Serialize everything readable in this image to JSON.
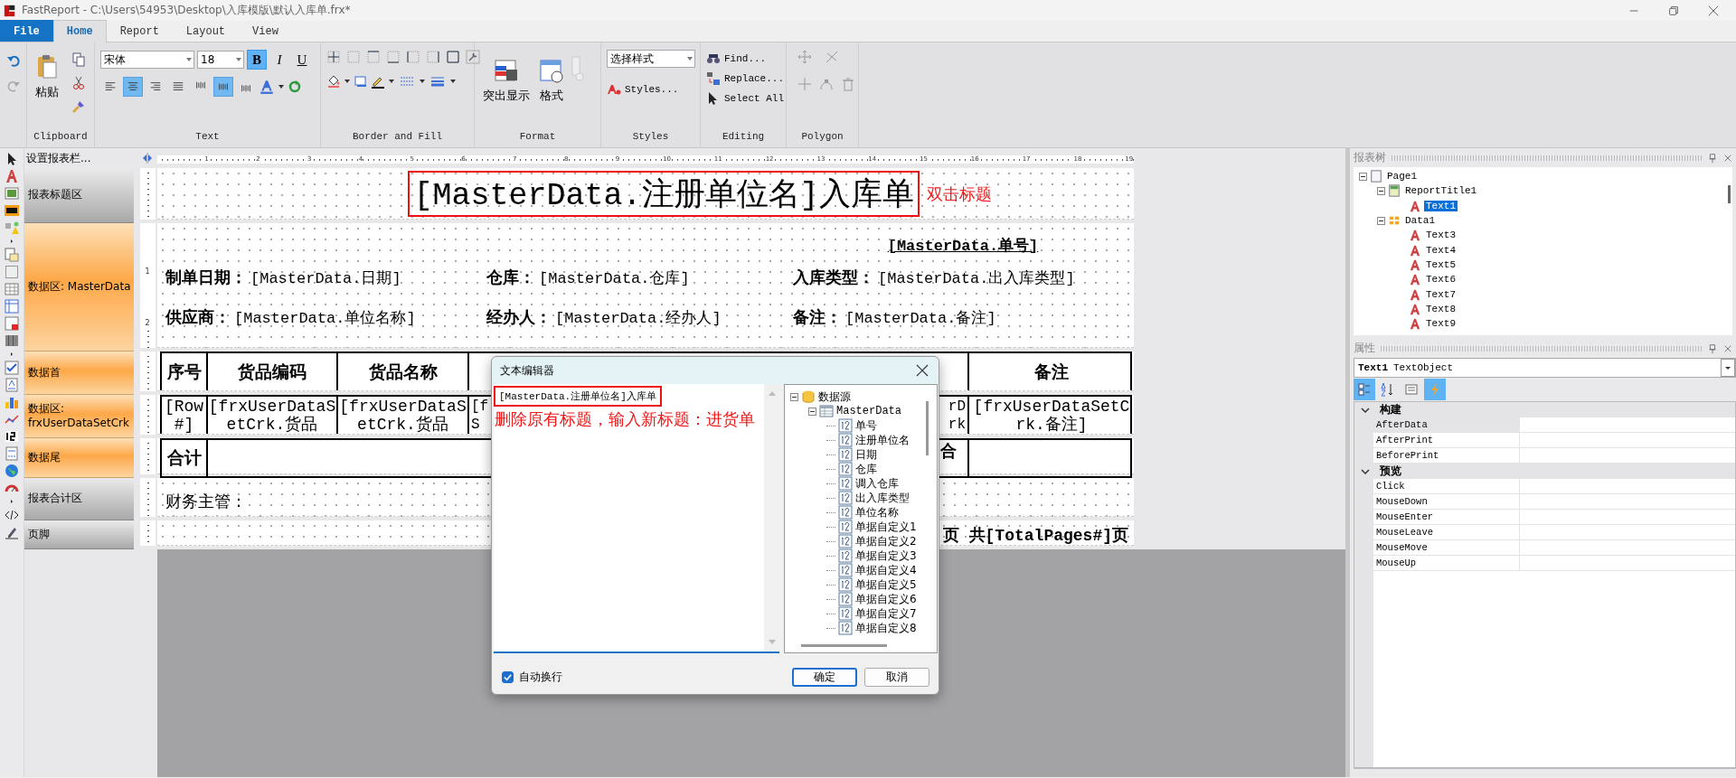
{
  "window": {
    "title": "FastReport - C:\\Users\\54953\\Desktop\\入库模版\\默认入库单.frx*"
  },
  "ribbon": {
    "tabs": [
      {
        "label": "File",
        "kind": "file",
        "selected": false
      },
      {
        "label": "Home",
        "kind": "tab",
        "selected": true
      },
      {
        "label": "Report",
        "kind": "tab",
        "selected": false
      },
      {
        "label": "Layout",
        "kind": "tab",
        "selected": false
      },
      {
        "label": "View",
        "kind": "tab",
        "selected": false
      }
    ],
    "groups": [
      {
        "kind": "clipboard",
        "label": "Clipboard",
        "paste": "粘贴"
      },
      {
        "kind": "text",
        "label": "Text",
        "font": "宋体",
        "size": "18",
        "styles": [
          {
            "label": "B",
            "selected": true
          },
          {
            "label": "I",
            "selected": false
          },
          {
            "label": "U",
            "selected": false
          }
        ],
        "align": [
          {
            "selected": false
          },
          {
            "selected": true
          },
          {
            "selected": false
          },
          {
            "selected": false
          }
        ],
        "valign": [
          {
            "selected": false
          },
          {
            "selected": true
          },
          {
            "selected": false
          }
        ]
      },
      {
        "kind": "border",
        "label": "Border and Fill"
      },
      {
        "kind": "format",
        "label": "Format",
        "buttons": [
          "突出显示",
          "格式"
        ]
      },
      {
        "kind": "styles",
        "label": "Styles",
        "combo": "选择样式",
        "button": "Styles..."
      },
      {
        "kind": "editing",
        "label": "Editing",
        "buttons": [
          "Find...",
          "Replace...",
          "Select All"
        ]
      },
      {
        "kind": "polygon",
        "label": "Polygon"
      }
    ]
  },
  "bands_panel": {
    "header": "设置报表栏...",
    "bands": [
      {
        "label": "报表标题区",
        "kind": "title"
      },
      {
        "label": "数据区: MasterData",
        "kind": "master",
        "ruler_marks": [
          "1",
          "2"
        ]
      },
      {
        "label": "数据首",
        "kind": "header"
      },
      {
        "label": "数据区: frxUserDataSetCrk",
        "kind": "detail"
      },
      {
        "label": "数据尾",
        "kind": "footer"
      },
      {
        "label": "报表合计区",
        "kind": "summary"
      },
      {
        "label": "页脚",
        "kind": "pagefooter"
      }
    ]
  },
  "ruler": {
    "marks": [
      "1",
      "2",
      "3",
      "4",
      "5",
      "6",
      "7",
      "8",
      "9",
      "10",
      "11",
      "12",
      "13",
      "14",
      "15",
      "16",
      "17",
      "18",
      "19"
    ]
  },
  "report": {
    "title": {
      "text": "[MasterData.注册单位名]入库单",
      "highlighted": true,
      "note": "双击标题"
    },
    "number": "[MasterData.单号]",
    "fields": [
      [
        {
          "label": "制单日期：",
          "value": "[MasterData.日期]"
        },
        {
          "label": "仓库：",
          "value": "[MasterData.仓库]"
        },
        {
          "label": "入库类型：",
          "value": "[MasterData.出入库类型]"
        }
      ],
      [
        {
          "label": "供应商：",
          "value": "[MasterData.单位名称]"
        },
        {
          "label": "经办人：",
          "value": "[MasterData.经办人]"
        },
        {
          "label": "备注：",
          "value": "[MasterData.备注]"
        }
      ]
    ],
    "table": {
      "columns": [
        "序号",
        "货品编码",
        "货品名称"
      ],
      "last_column": "备注",
      "row": [
        "[Row #]",
        "[frxUserDataSetCrk.货品",
        "[frxUserDataSetCrk.货品"
      ],
      "fragment_left": [
        "[f",
        "S"
      ],
      "fragment_right": [
        "rD",
        "rk"
      ],
      "last_cell": "[frxUserDataSetCrk.备注]",
      "total_label": "合计",
      "total_fragment": "合"
    },
    "summary_label": "财务主管：",
    "page_footer": "页 共[TotalPages#]页"
  },
  "dialog": {
    "title": "文本编辑器",
    "text": "[MasterData.注册单位名]入库单",
    "highlighted": true,
    "note": "删除原有标题，输入新标题：进货单",
    "tree": [
      {
        "label": "数据源",
        "kind": "source",
        "expanded": true,
        "children": [
          {
            "label": "MasterData",
            "kind": "table",
            "expanded": true,
            "children": [
              {
                "label": "单号",
                "kind": "field"
              },
              {
                "label": "注册单位名",
                "kind": "field"
              },
              {
                "label": "日期",
                "kind": "field"
              },
              {
                "label": "仓库",
                "kind": "field"
              },
              {
                "label": "调入仓库",
                "kind": "field"
              },
              {
                "label": "出入库类型",
                "kind": "field"
              },
              {
                "label": "单位名称",
                "kind": "field"
              },
              {
                "label": "单据自定义1",
                "kind": "field"
              },
              {
                "label": "单据自定义2",
                "kind": "field"
              },
              {
                "label": "单据自定义3",
                "kind": "field"
              },
              {
                "label": "单据自定义4",
                "kind": "field"
              },
              {
                "label": "单据自定义5",
                "kind": "field"
              },
              {
                "label": "单据自定义6",
                "kind": "field"
              },
              {
                "label": "单据自定义7",
                "kind": "field"
              },
              {
                "label": "单据自定义8",
                "kind": "field"
              }
            ]
          }
        ]
      }
    ],
    "word_wrap": {
      "label": "自动换行",
      "checked": true
    },
    "buttons": [
      {
        "label": "确定",
        "default": true
      },
      {
        "label": "取消",
        "default": false
      }
    ]
  },
  "report_tree": {
    "title": "报表树",
    "items": [
      {
        "label": "Page1",
        "kind": "page",
        "expanded": true,
        "selected": false,
        "children": [
          {
            "label": "ReportTitle1",
            "kind": "band",
            "expanded": true,
            "selected": false,
            "children": [
              {
                "label": "Text1",
                "kind": "text",
                "selected": true
              }
            ]
          },
          {
            "label": "Data1",
            "kind": "data",
            "expanded": true,
            "selected": false,
            "children": [
              {
                "label": "Text3",
                "kind": "text",
                "selected": false
              },
              {
                "label": "Text4",
                "kind": "text",
                "selected": false
              },
              {
                "label": "Text5",
                "kind": "text",
                "selected": false
              },
              {
                "label": "Text6",
                "kind": "text",
                "selected": false
              },
              {
                "label": "Text7",
                "kind": "text",
                "selected": false
              },
              {
                "label": "Text8",
                "kind": "text",
                "selected": false
              },
              {
                "label": "Text9",
                "kind": "text",
                "selected": false
              }
            ]
          }
        ]
      }
    ]
  },
  "properties": {
    "title": "属性",
    "object_name": "Text1",
    "object_type": "TextObject",
    "toolbar": [
      {
        "selected": true
      },
      {
        "selected": false
      },
      {
        "selected": false
      },
      {
        "selected": true
      }
    ],
    "categories": [
      {
        "label": "构建",
        "expanded": true,
        "rows": [
          {
            "name": "AfterData",
            "selected": true
          },
          {
            "name": "AfterPrint",
            "selected": false
          },
          {
            "name": "BeforePrint",
            "selected": false
          }
        ]
      },
      {
        "label": "预览",
        "expanded": true,
        "rows": [
          {
            "name": "Click",
            "selected": false
          },
          {
            "name": "MouseDown",
            "selected": false
          },
          {
            "name": "MouseEnter",
            "selected": false
          },
          {
            "name": "MouseLeave",
            "selected": false
          },
          {
            "name": "MouseMove",
            "selected": false
          },
          {
            "name": "MouseUp",
            "selected": false
          }
        ]
      }
    ]
  }
}
